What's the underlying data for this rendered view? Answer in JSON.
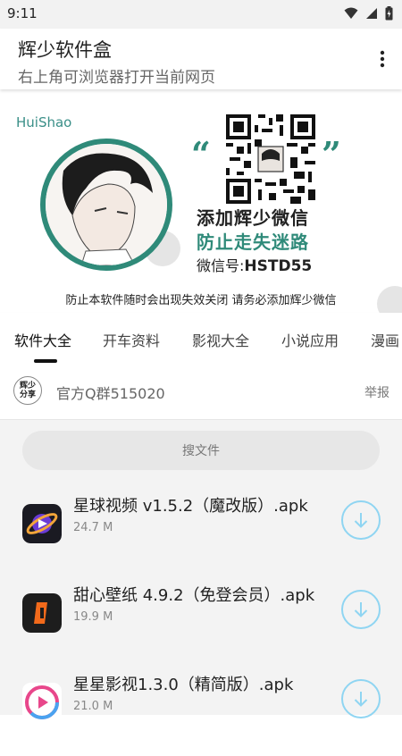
{
  "status_bar": {
    "time": "9:11"
  },
  "app_bar": {
    "title": "辉少软件盒",
    "subtitle": "右上角可浏览器打开当前网页",
    "menu_icon": "more-vertical-icon"
  },
  "banner": {
    "brand": "HuiShao",
    "quote_open": "“",
    "quote_close": "”",
    "line1": "添加辉少微信",
    "line2": "防止走失迷路",
    "wechat_label": "微信号:",
    "wechat_id": "HSTD55",
    "notice": "防止本软件随时会出现失效关闭 请务必添加辉少微信",
    "accent_color": "#2f8a79"
  },
  "tabs": [
    {
      "label": "软件大全",
      "active": true
    },
    {
      "label": "开车资料",
      "active": false
    },
    {
      "label": "影视大全",
      "active": false
    },
    {
      "label": "小说应用",
      "active": false
    },
    {
      "label": "漫画",
      "active": false
    }
  ],
  "group_row": {
    "logo_text_top": "辉少",
    "logo_text_bottom": "分享",
    "text": "官方Q群515020",
    "report": "举报"
  },
  "search": {
    "placeholder": "搜文件"
  },
  "files": [
    {
      "name": "星球视频 v1.5.2（魔改版）.apk",
      "size": "24.7 M",
      "icon": "planet-app-icon"
    },
    {
      "name": "甜心壁纸 4.9.2（免登会员）.apk",
      "size": "19.9 M",
      "icon": "wallpaper-app-icon"
    },
    {
      "name": "星星影视1.3.0（精简版）.apk",
      "size": "21.0 M",
      "icon": "play-app-icon"
    }
  ],
  "download_icon": "download-icon",
  "download_color": "#8fd5f2"
}
